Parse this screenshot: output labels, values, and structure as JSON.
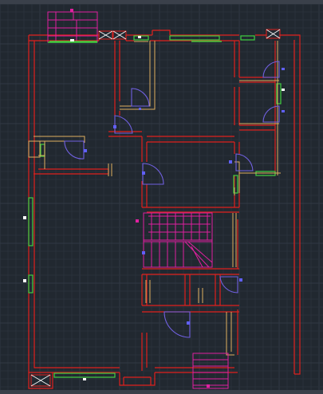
{
  "viewport": {
    "title": "",
    "background": "#212830"
  },
  "colors": {
    "grid_minor": "#29313a",
    "grid_major": "#313944",
    "wall": "#e0201c",
    "door": "#7060e0",
    "window": "#40d040",
    "stair": "#e020a0",
    "furniture": "#e0b060",
    "grip": "#6060ff",
    "white_grip": "#ffffff",
    "column_x": "#ffffff"
  },
  "layers": [
    "walls",
    "doors",
    "windows",
    "stairs",
    "fixtures",
    "grips"
  ]
}
